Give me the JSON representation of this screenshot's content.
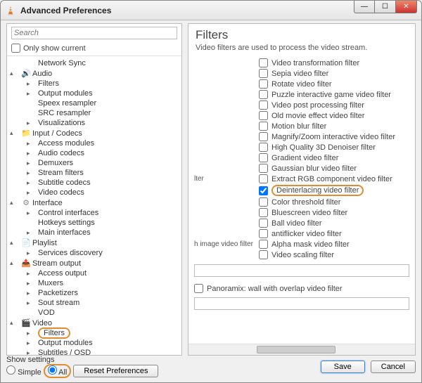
{
  "window": {
    "title": "Advanced Preferences"
  },
  "left": {
    "search_placeholder": "Search",
    "only_show_current": "Only show current",
    "tree": [
      {
        "type": "child",
        "exp": "",
        "label": "Network Sync"
      },
      {
        "type": "cat",
        "exp": "▴",
        "icon": "🔊",
        "icon_color": "#3a8a3a",
        "label": "Audio"
      },
      {
        "type": "child",
        "exp": "▸",
        "label": "Filters"
      },
      {
        "type": "child",
        "exp": "▸",
        "label": "Output modules"
      },
      {
        "type": "child",
        "exp": "",
        "label": "Speex resampler"
      },
      {
        "type": "child",
        "exp": "",
        "label": "SRC resampler"
      },
      {
        "type": "child",
        "exp": "▸",
        "label": "Visualizations"
      },
      {
        "type": "cat",
        "exp": "▴",
        "icon": "📁",
        "icon_color": "#cc9a3a",
        "label": "Input / Codecs"
      },
      {
        "type": "child",
        "exp": "▸",
        "label": "Access modules"
      },
      {
        "type": "child",
        "exp": "▸",
        "label": "Audio codecs"
      },
      {
        "type": "child",
        "exp": "▸",
        "label": "Demuxers"
      },
      {
        "type": "child",
        "exp": "▸",
        "label": "Stream filters"
      },
      {
        "type": "child",
        "exp": "▸",
        "label": "Subtitle codecs"
      },
      {
        "type": "child",
        "exp": "▸",
        "label": "Video codecs"
      },
      {
        "type": "cat",
        "exp": "▴",
        "icon": "⚙",
        "icon_color": "#888",
        "label": "Interface"
      },
      {
        "type": "child",
        "exp": "▸",
        "label": "Control interfaces"
      },
      {
        "type": "child",
        "exp": "",
        "label": "Hotkeys settings"
      },
      {
        "type": "child",
        "exp": "▸",
        "label": "Main interfaces"
      },
      {
        "type": "cat",
        "exp": "▴",
        "icon": "📄",
        "icon_color": "#888",
        "label": "Playlist"
      },
      {
        "type": "child",
        "exp": "▸",
        "label": "Services discovery"
      },
      {
        "type": "cat",
        "exp": "▴",
        "icon": "📤",
        "icon_color": "#cc9a3a",
        "label": "Stream output"
      },
      {
        "type": "child",
        "exp": "▸",
        "label": "Access output"
      },
      {
        "type": "child",
        "exp": "▸",
        "label": "Muxers"
      },
      {
        "type": "child",
        "exp": "▸",
        "label": "Packetizers"
      },
      {
        "type": "child",
        "exp": "▸",
        "label": "Sout stream"
      },
      {
        "type": "child",
        "exp": "",
        "label": "VOD"
      },
      {
        "type": "cat",
        "exp": "▴",
        "icon": "🎬",
        "icon_color": "#3355cc",
        "label": "Video"
      },
      {
        "type": "child",
        "exp": "▸",
        "label": "Filters",
        "highlight": true
      },
      {
        "type": "child",
        "exp": "▸",
        "label": "Output modules"
      },
      {
        "type": "child",
        "exp": "▸",
        "label": "Subtitles / OSD"
      }
    ]
  },
  "right": {
    "title": "Filters",
    "subtitle": "Video filters are used to process the video stream.",
    "rows": [
      {
        "left": "",
        "label": "Video transformation filter",
        "checked": false
      },
      {
        "left": "",
        "label": "Sepia video filter",
        "checked": false
      },
      {
        "left": "",
        "label": "Rotate video filter",
        "checked": false
      },
      {
        "left": "",
        "label": "Puzzle interactive game video filter",
        "checked": false
      },
      {
        "left": "",
        "label": "Video post processing filter",
        "checked": false
      },
      {
        "left": "",
        "label": "Old movie effect video filter",
        "checked": false
      },
      {
        "left": "",
        "label": "Motion blur filter",
        "checked": false
      },
      {
        "left": "",
        "label": "Magnify/Zoom interactive video filter",
        "checked": false
      },
      {
        "left": "",
        "label": "High Quality 3D Denoiser filter",
        "checked": false
      },
      {
        "left": "",
        "label": "Gradient video filter",
        "checked": false
      },
      {
        "left": "",
        "label": "Gaussian blur video filter",
        "checked": false
      },
      {
        "left": "lter",
        "label": "Extract RGB component video filter",
        "checked": false
      },
      {
        "left": "",
        "label": "Deinterlacing video filter",
        "checked": true,
        "highlight": true
      },
      {
        "left": "",
        "label": "Color threshold filter",
        "checked": false
      },
      {
        "left": "",
        "label": "Bluescreen video filter",
        "checked": false
      },
      {
        "left": "",
        "label": "Ball video filter",
        "checked": false
      },
      {
        "left": "",
        "label": "antiflicker video filter",
        "checked": false
      },
      {
        "left": "h image video filter",
        "label": "Alpha mask video filter",
        "checked": false
      },
      {
        "left": "",
        "label": "Video scaling filter",
        "checked": false
      }
    ],
    "panoramix": "Panoramix: wall with overlap video filter"
  },
  "footer": {
    "show_settings_label": "Show settings",
    "simple": "Simple",
    "all": "All",
    "reset": "Reset Preferences",
    "save": "Save",
    "cancel": "Cancel"
  }
}
